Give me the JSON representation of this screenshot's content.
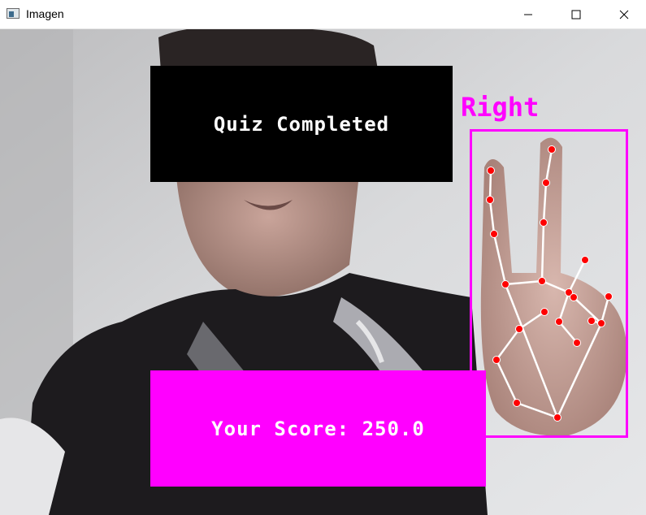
{
  "window": {
    "title": "Imagen",
    "controls": [
      "minimize-icon",
      "maximize-icon",
      "close-icon"
    ]
  },
  "overlay": {
    "status_text": "Quiz Completed",
    "score_text": "Your Score: 250.0",
    "handedness_label": "Right",
    "colors": {
      "status_box": "#000000",
      "score_box": "#ff00ff",
      "landmark": "#ff0000",
      "connection": "#ffffff",
      "hand_box": "#ff00ff"
    }
  }
}
